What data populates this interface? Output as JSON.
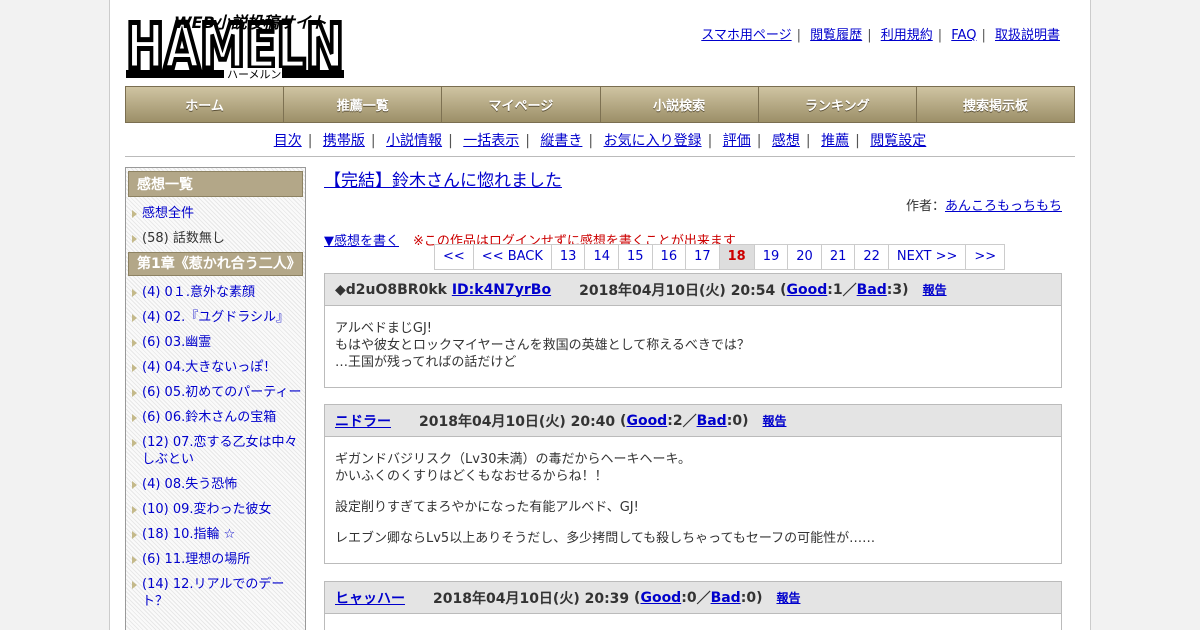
{
  "header": {
    "logo_text": "HAMELN",
    "logo_sub_top": "WEB小説投稿サイト",
    "logo_sub_bottom": "ハーメルン",
    "links": [
      "スマホ用ページ",
      "閲覧履歴",
      "利用規約",
      "FAQ",
      "取扱説明書"
    ]
  },
  "mainnav": [
    "ホーム",
    "推薦一覧",
    "マイページ",
    "小説検索",
    "ランキング",
    "捜索掲示板"
  ],
  "subnav": [
    "目次",
    "携帯版",
    "小説情報",
    "一括表示",
    "縦書き",
    "お気に入り登録",
    "評価",
    "感想",
    "推薦",
    "閲覧設定"
  ],
  "sidebar": {
    "heading": "感想一覧",
    "top_items": [
      {
        "label": "感想全件",
        "link": true
      },
      {
        "label": "(58) 話数無し",
        "link": false
      }
    ],
    "chapter_heading": "第1章《惹かれ合う二人》",
    "chapter_items": [
      "(4) 0１.意外な素顔",
      "(4) 02.『ユグドラシル』",
      "(6) 03.幽霊",
      "(4) 04.大きないっぽ！",
      "(6) 05.初めてのパーティー",
      "(6) 06.鈴木さんの宝箱",
      "(12) 07.恋する乙女は中々しぶとい",
      "(4) 08.失う恐怖",
      "(10) 09.変わった彼女",
      "(18) 10.指輪 ☆",
      "(6) 11.理想の場所",
      "(14) 12.リアルでのデート？"
    ]
  },
  "content": {
    "title": "【完結】鈴木さんに惚れました",
    "author_label": "作者：",
    "author": "あんころもっちもち",
    "write_link": "▼感想を書く",
    "notice": "※この作品はログインせずに感想を書くことが出来ます",
    "pager": [
      "<<",
      "<< BACK",
      "13",
      "14",
      "15",
      "16",
      "17",
      "18",
      "19",
      "20",
      "21",
      "22",
      "NEXT >>",
      ">>"
    ],
    "current_page": "18"
  },
  "comments": [
    {
      "name": "◆d2uO8BR0kk",
      "id_link": "ID:k4N7yrBo",
      "date": "2018年04月10日(火) 20:54",
      "good": "1",
      "bad": "3",
      "body": [
        "アルベドまじGJ!\nもはや彼女とロックマイヤーさんを救国の英雄として称えるべきでは？\n…王国が残ってればの話だけど"
      ]
    },
    {
      "name": "ニドラー",
      "id_link": "",
      "date": "2018年04月10日(火) 20:40",
      "good": "2",
      "bad": "0",
      "body": [
        "ギガンドバジリスク（Lv30未満）の毒だからヘーキヘーキ。\nかいふくのくすりはどくもなおせるからね！！",
        "設定削りすぎてまろやかになった有能アルベド、GJ!",
        "レエブン卿ならLv5以上ありそうだし、多少拷問しても殺しちゃってもセーフの可能性が……"
      ]
    },
    {
      "name": "ヒャッハー",
      "id_link": "",
      "date": "2018年04月10日(火) 20:39",
      "good": "0",
      "bad": "0",
      "body": []
    }
  ],
  "labels": {
    "good": "Good",
    "bad": "Bad",
    "report": "報告"
  }
}
